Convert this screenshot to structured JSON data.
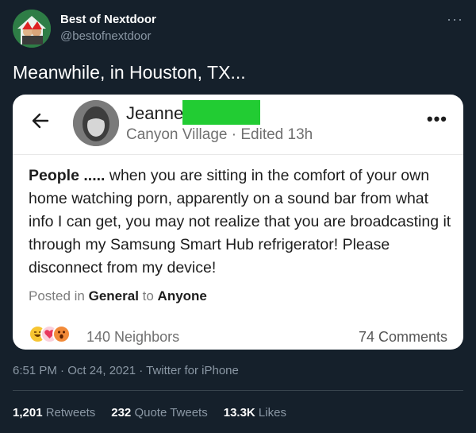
{
  "account": {
    "name": "Best of Nextdoor",
    "handle": "@bestofnextdoor"
  },
  "tweet": {
    "text": "Meanwhile, in Houston, TX...",
    "timestamp": "6:51 PM · Oct 24, 2021 · Twitter for iPhone"
  },
  "post": {
    "author": "Jeanne",
    "location": "Canyon Village",
    "edited": " · Edited 13h",
    "body_lead": "People .....",
    "body_rest": " when you are sitting in the comfort of your own home watching porn, apparently on a sound bar from what info I can get, you may not realize that you are broadcasting it through my Samsung Smart Hub refrigerator! Please disconnect from my device!",
    "posted_prefix": "Posted in ",
    "category": "General",
    "to_word": " to ",
    "audience": "Anyone",
    "neighbors": "140 Neighbors",
    "comments": "74 Comments",
    "redaction_color": "#22cc33"
  },
  "stats": {
    "retweets_count": "1,201",
    "retweets_label": " Retweets",
    "quotes_count": "232",
    "quotes_label": " Quote Tweets",
    "likes_count": "13.3K",
    "likes_label": " Likes"
  },
  "icons": {
    "more": "more-dots-icon",
    "back": "back-arrow-icon",
    "reactions": [
      "laugh-emoji-icon",
      "heart-emoji-icon",
      "surprised-emoji-icon"
    ]
  },
  "colors": {
    "background": "#15202b",
    "secondary_text": "#8b98a5",
    "card": "#ffffff"
  }
}
